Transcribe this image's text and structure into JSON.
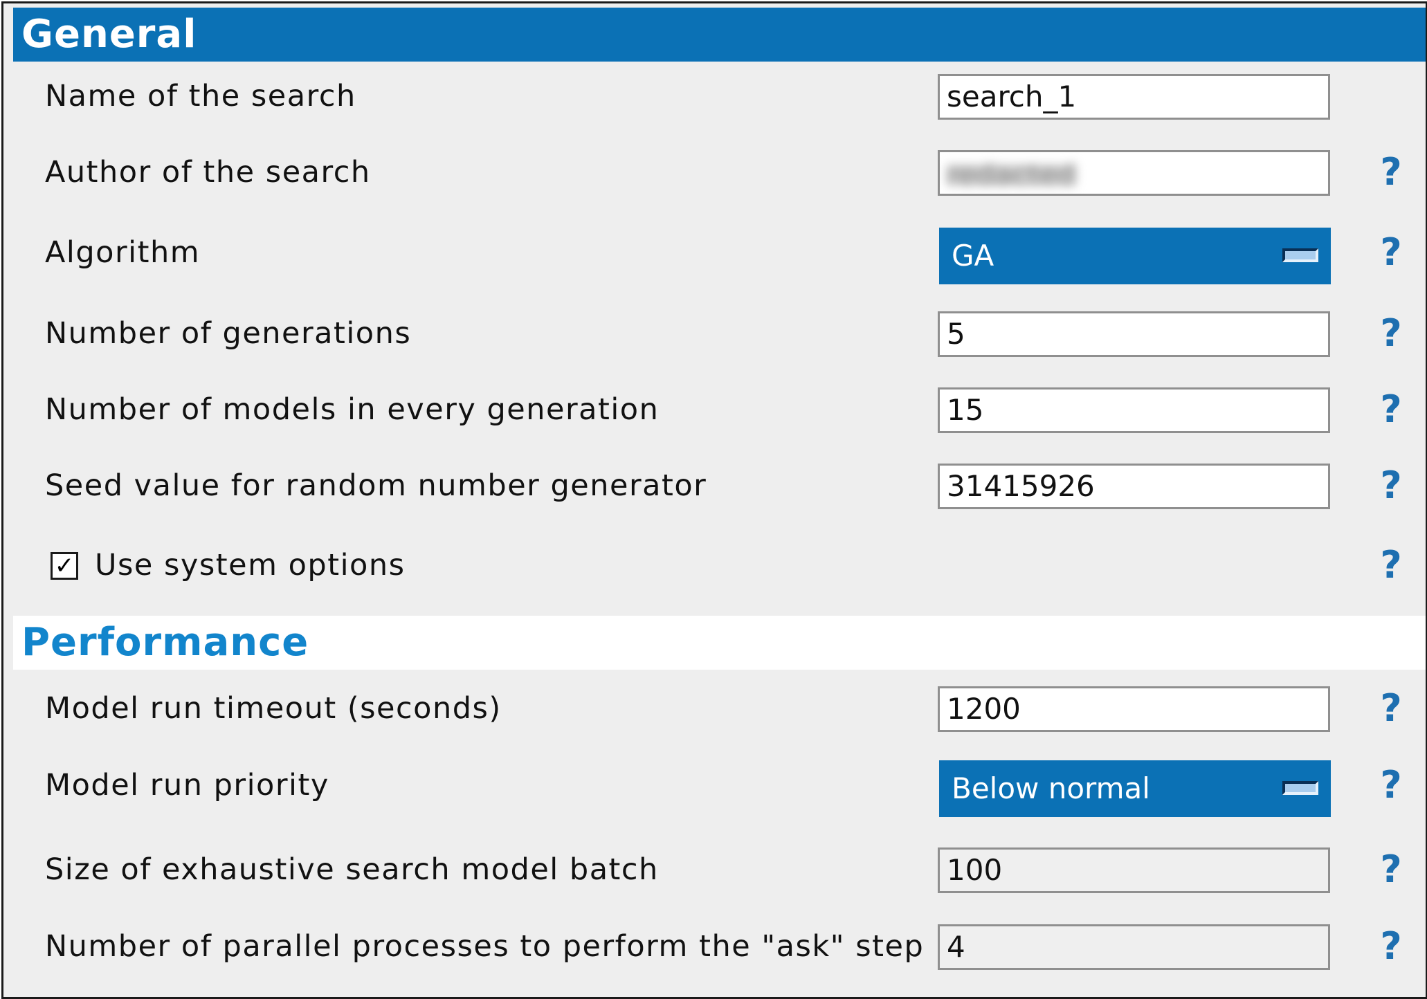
{
  "general": {
    "title": "General",
    "search_name": {
      "label": "Name of the search",
      "value": "search_1"
    },
    "author": {
      "label": "Author of the search",
      "value": "redacted"
    },
    "algorithm": {
      "label": "Algorithm",
      "value": "GA"
    },
    "generations": {
      "label": "Number of generations",
      "value": "5"
    },
    "models_per_generation": {
      "label": "Number of models in every generation",
      "value": "15"
    },
    "seed": {
      "label": "Seed value for random number generator",
      "value": "31415926"
    },
    "use_system_options": {
      "label": "Use system options",
      "checked": true,
      "check_glyph": "✓"
    },
    "help_glyph": "?"
  },
  "performance": {
    "title": "Performance",
    "timeout": {
      "label": "Model run timeout (seconds)",
      "value": "1200"
    },
    "priority": {
      "label": "Model run priority",
      "value": "Below normal"
    },
    "batch_size": {
      "label": "Size of exhaustive search model batch",
      "value": "100"
    },
    "parallel_processes": {
      "label": "Number of parallel processes to perform the \"ask\" step",
      "value": "4"
    }
  },
  "colors": {
    "header_blue": "#0b71b5",
    "section_title_blue": "#1285cc",
    "help_blue": "#1e6fb0",
    "panel_background": "#eeeeee"
  }
}
